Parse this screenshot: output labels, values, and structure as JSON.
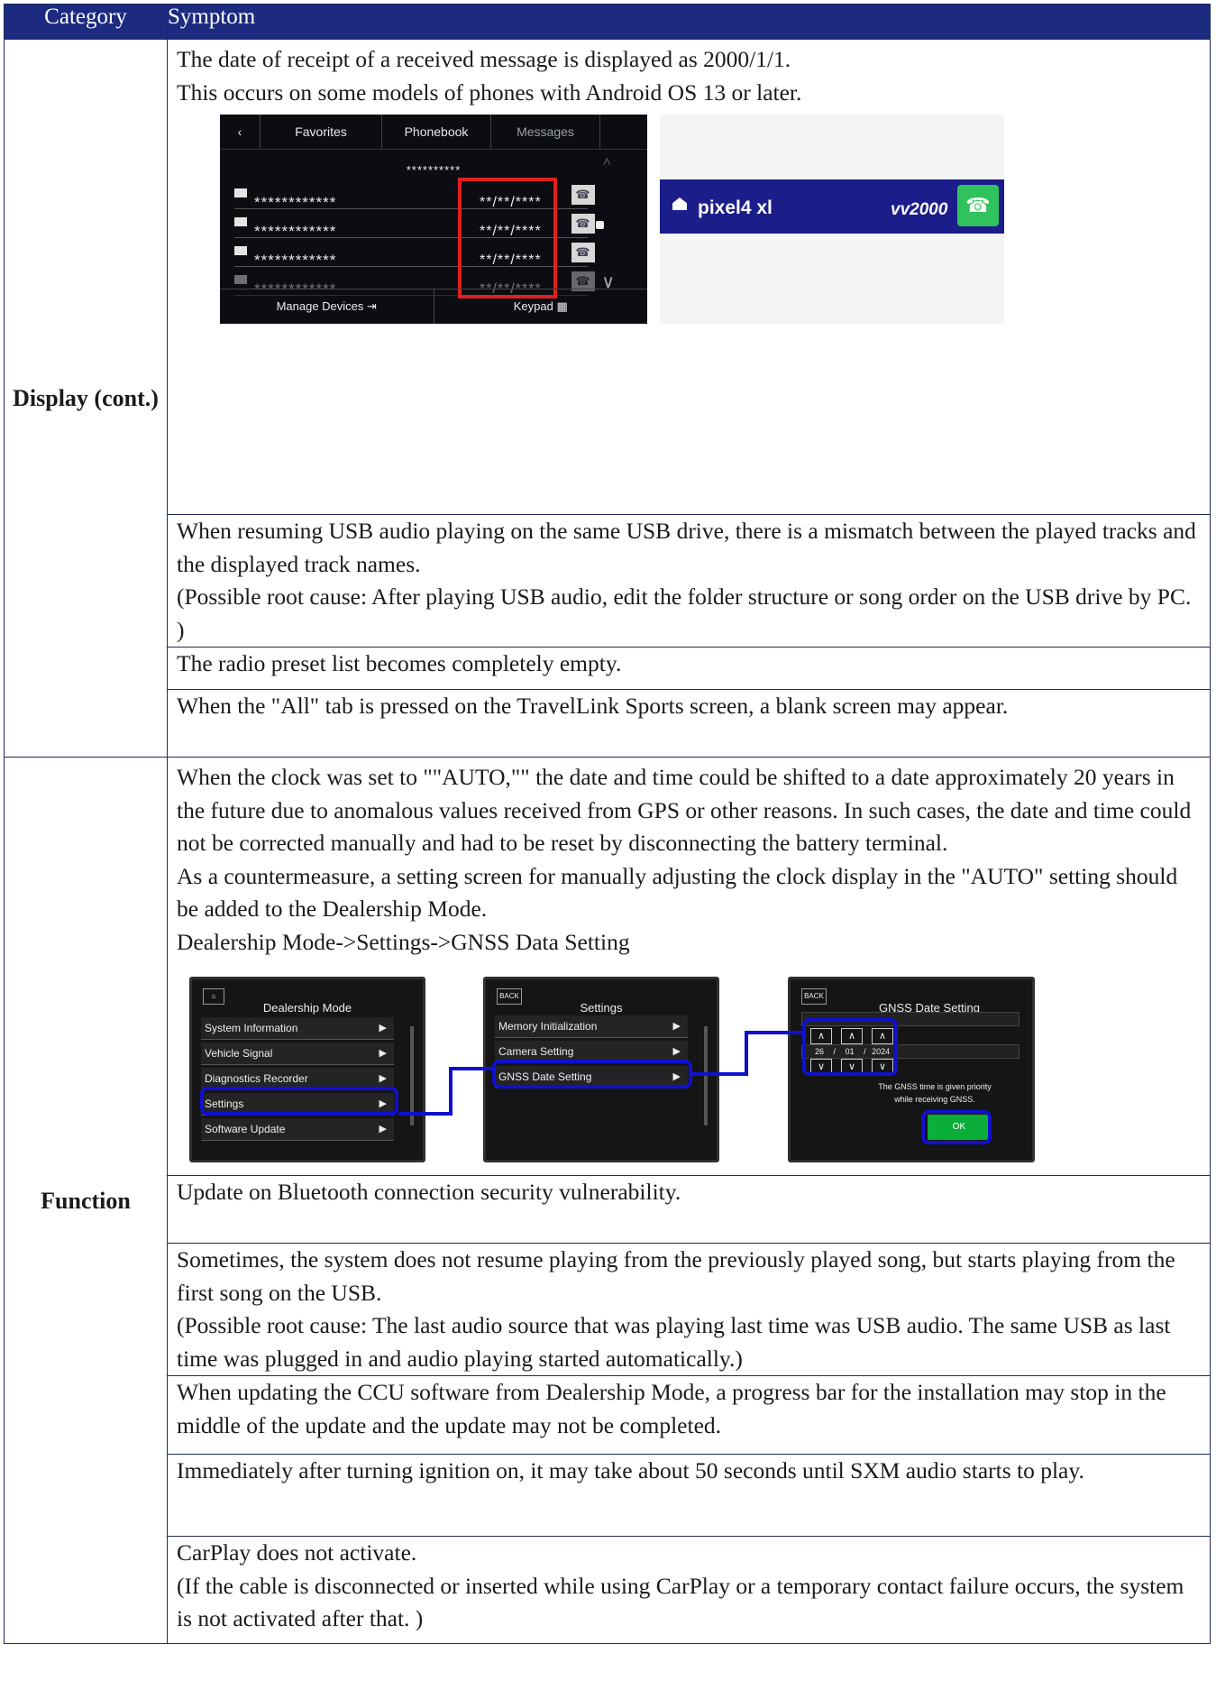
{
  "header": {
    "category": "Category",
    "symptom": "Symptom"
  },
  "sections": {
    "display": {
      "category": "Display (cont.)",
      "intro": [
        "The date of receipt of a received message is displayed as 2000/1/1.",
        "This occurs on some models of phones with Android OS 13 or later."
      ],
      "phone_screen": {
        "tabs": [
          "Favorites",
          "Phonebook",
          "Messages"
        ],
        "contact": "**********",
        "rows": [
          {
            "name": "************",
            "date": "**/**/****"
          },
          {
            "name": "************",
            "date": "**/**/****"
          },
          {
            "name": "************",
            "date": "**/**/****"
          },
          {
            "name": "************",
            "date": "**/**/****"
          }
        ],
        "bottom": [
          "Manage Devices",
          "Keypad"
        ]
      },
      "notification": {
        "device": "pixel4 xl",
        "number": "vv2000"
      },
      "rows": [
        [
          "When resuming USB audio playing on the same USB drive, there is a mismatch between the played tracks and the displayed track names.",
          "(Possible root cause: After playing USB audio, edit the folder structure or song order on the USB drive by PC. )"
        ],
        [
          "The radio preset list becomes completely empty."
        ],
        [
          "When the \"All\" tab is pressed on the TravelLink Sports screen, a blank screen may appear."
        ]
      ]
    },
    "function": {
      "category": "Function",
      "intro": [
        "When the clock was set to \"\"AUTO,\"\" the date and time could be shifted to a date approximately 20 years in the future due to anomalous values received from GPS or other reasons. In such cases, the date and time could not be corrected manually and had to be reset by disconnecting the battery terminal.",
        "As a countermeasure, a setting screen for manually adjusting the clock display in the \"AUTO\" setting should be added to the Dealership Mode.",
        "Dealership Mode->Settings->GNSS Data Setting"
      ],
      "dealership_screen": {
        "title": "Dealership Mode",
        "items": [
          "System Information",
          "Vehicle Signal",
          "Diagnostics Recorder",
          "Settings",
          "Software Update"
        ]
      },
      "settings_screen": {
        "back": "BACK",
        "title": "Settings",
        "items": [
          "Memory Initialization",
          "Camera Setting",
          "GNSS Date Setting"
        ]
      },
      "gnss_screen": {
        "back": "BACK",
        "title": "GNSS Date Setting",
        "day": "26",
        "month": "01",
        "year": "2024",
        "note": [
          "The GNSS time is given priority",
          "while receiving GNSS."
        ],
        "ok": "OK"
      },
      "rows": [
        [
          "Update on Bluetooth connection security vulnerability."
        ],
        [
          "Sometimes, the system does not resume playing from the previously played song, but starts playing from the first song on the USB.",
          "(Possible root cause: The last audio source that was playing last time was USB audio. The same USB as last time was plugged in and audio playing started automatically.)"
        ],
        [
          "When updating the CCU software from Dealership Mode, a progress bar for the installation may stop in the middle of the update and the update may not be completed."
        ],
        [
          "Immediately after turning ignition on, it may take about 50 seconds until SXM audio starts to play."
        ],
        [
          "CarPlay does not activate.",
          "(If the cable is disconnected or inserted while using CarPlay or a temporary contact failure occurs, the system is not activated after that. )"
        ]
      ]
    }
  }
}
